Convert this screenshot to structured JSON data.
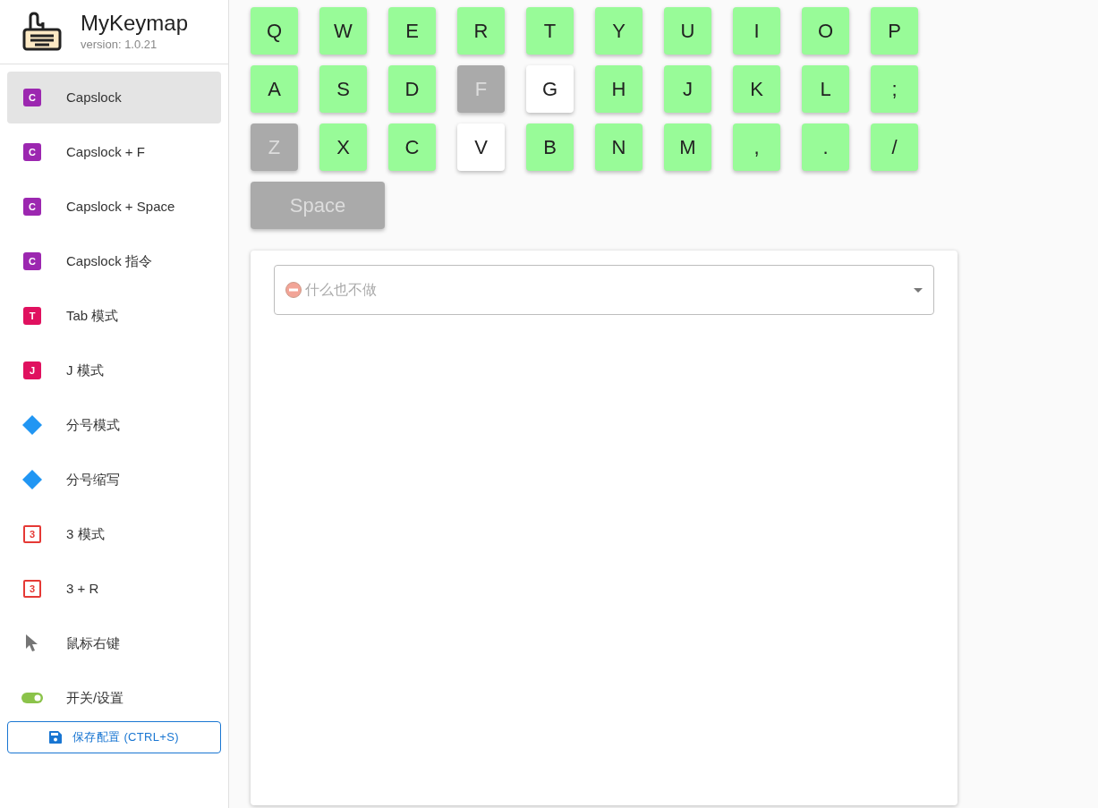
{
  "app": {
    "title": "MyKeymap",
    "version": "version: 1.0.21"
  },
  "sidebar": {
    "items": [
      {
        "label": "Capslock",
        "selected": true,
        "icon": {
          "kind": "badge",
          "text": "C",
          "color": "#9c27b0"
        }
      },
      {
        "label": "Capslock + F",
        "selected": false,
        "icon": {
          "kind": "badge",
          "text": "C",
          "color": "#9c27b0"
        }
      },
      {
        "label": "Capslock + Space",
        "selected": false,
        "icon": {
          "kind": "badge",
          "text": "C",
          "color": "#9c27b0"
        }
      },
      {
        "label": "Capslock 指令",
        "selected": false,
        "icon": {
          "kind": "badge",
          "text": "C",
          "color": "#9c27b0"
        }
      },
      {
        "label": "Tab 模式",
        "selected": false,
        "icon": {
          "kind": "badge",
          "text": "T",
          "color": "#e0115f"
        }
      },
      {
        "label": "J 模式",
        "selected": false,
        "icon": {
          "kind": "badge",
          "text": "J",
          "color": "#e0115f"
        }
      },
      {
        "label": "分号模式",
        "selected": false,
        "icon": {
          "kind": "diamond"
        }
      },
      {
        "label": "分号缩写",
        "selected": false,
        "icon": {
          "kind": "diamond"
        }
      },
      {
        "label": "3 模式",
        "selected": false,
        "icon": {
          "kind": "outlined",
          "text": "3"
        }
      },
      {
        "label": "3 + R",
        "selected": false,
        "icon": {
          "kind": "outlined",
          "text": "3"
        }
      },
      {
        "label": "鼠标右键",
        "selected": false,
        "icon": {
          "kind": "cursor"
        }
      },
      {
        "label": "开关/设置",
        "selected": false,
        "icon": {
          "kind": "toggle"
        }
      }
    ],
    "save_button": "保存配置 (CTRL+S)"
  },
  "keyboard": {
    "rows": [
      [
        {
          "label": "Q",
          "kind": "mapped"
        },
        {
          "label": "W",
          "kind": "mapped"
        },
        {
          "label": "E",
          "kind": "mapped"
        },
        {
          "label": "R",
          "kind": "mapped"
        },
        {
          "label": "T",
          "kind": "mapped"
        },
        {
          "label": "Y",
          "kind": "mapped"
        },
        {
          "label": "U",
          "kind": "mapped"
        },
        {
          "label": "I",
          "kind": "mapped"
        },
        {
          "label": "O",
          "kind": "mapped"
        },
        {
          "label": "P",
          "kind": "mapped"
        }
      ],
      [
        {
          "label": "A",
          "kind": "mapped"
        },
        {
          "label": "S",
          "kind": "mapped"
        },
        {
          "label": "D",
          "kind": "mapped"
        },
        {
          "label": "F",
          "kind": "disabled"
        },
        {
          "label": "G",
          "kind": "empty"
        },
        {
          "label": "H",
          "kind": "mapped"
        },
        {
          "label": "J",
          "kind": "mapped"
        },
        {
          "label": "K",
          "kind": "mapped"
        },
        {
          "label": "L",
          "kind": "mapped"
        },
        {
          "label": ";",
          "kind": "mapped"
        }
      ],
      [
        {
          "label": "Z",
          "kind": "disabled"
        },
        {
          "label": "X",
          "kind": "mapped"
        },
        {
          "label": "C",
          "kind": "mapped"
        },
        {
          "label": "V",
          "kind": "empty"
        },
        {
          "label": "B",
          "kind": "mapped"
        },
        {
          "label": "N",
          "kind": "mapped"
        },
        {
          "label": "M",
          "kind": "mapped"
        },
        {
          "label": ",",
          "kind": "mapped"
        },
        {
          "label": ".",
          "kind": "mapped"
        },
        {
          "label": "/",
          "kind": "mapped"
        }
      ]
    ],
    "space_key": {
      "label": "Space",
      "kind": "disabled"
    }
  },
  "action_select": {
    "placeholder": "什么也不做"
  }
}
